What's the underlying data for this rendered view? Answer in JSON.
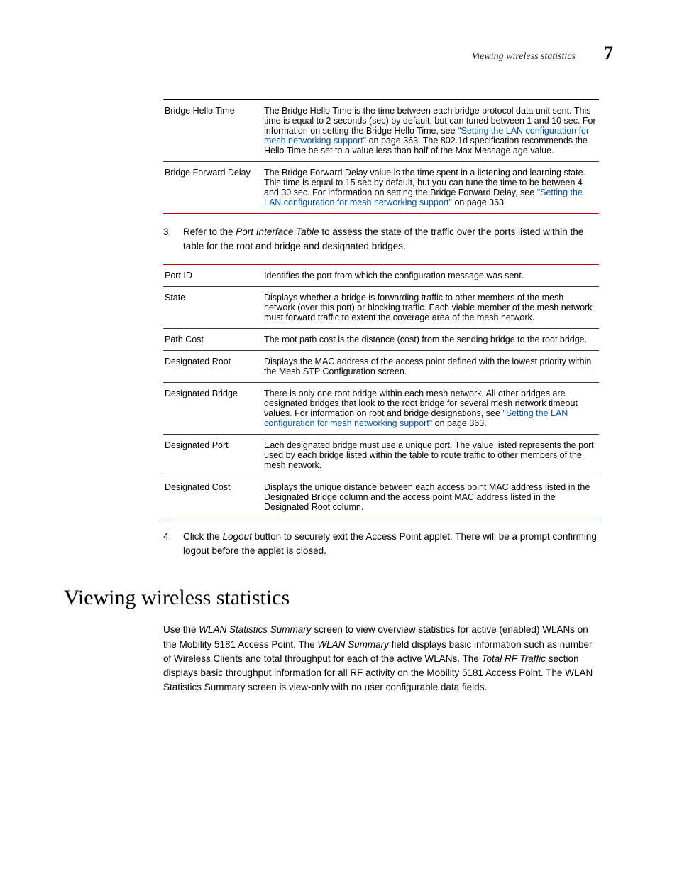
{
  "header": {
    "title": "Viewing wireless statistics",
    "chapter": "7"
  },
  "table1": {
    "rows": [
      {
        "term": "Bridge Hello Time",
        "desc_a": "The Bridge Hello Time is the time between each bridge protocol data unit sent. This time is equal to 2 seconds (sec) by default, but can tuned between 1 and 10 sec. For information on setting the Bridge Hello Time, see ",
        "link": "\"Setting the LAN configuration for mesh networking support\"",
        "desc_b": " on page 363. The 802.1d specification recommends the Hello Time be set to a value less than half of the Max Message age value."
      },
      {
        "term": "Bridge Forward Delay",
        "desc_a": "The Bridge Forward Delay value is the time spent in a listening and learning state. This time is equal to 15 sec by default, but you can tune the time to be between 4 and 30 sec. For information on setting the Bridge Forward Delay, see ",
        "link": "\"Setting the LAN configuration for mesh networking support\"",
        "desc_b": " on page 363."
      }
    ]
  },
  "step3": {
    "num": "3.",
    "a": "Refer to the ",
    "i": "Port Interface Table",
    "b": " to assess the state of the traffic over the ports listed within the table for the root and bridge and designated bridges."
  },
  "table2": {
    "rows": [
      {
        "term": "Port ID",
        "desc": "Identifies the port from which the configuration message was sent."
      },
      {
        "term": "State",
        "desc": "Displays whether a bridge is forwarding traffic to other members of the mesh network (over this port) or blocking traffic. Each viable member of the mesh network must forward traffic to extent the coverage area of the mesh network."
      },
      {
        "term": "Path Cost",
        "desc": "The root path cost is the distance (cost) from the sending bridge to the root bridge."
      },
      {
        "term": "Designated Root",
        "desc": "Displays the MAC address of the access point defined with the lowest priority within the Mesh STP Configuration screen."
      },
      {
        "term": "Designated Bridge",
        "desc_a": "There is only one root bridge within each mesh network. All other bridges are designated bridges that look to the root bridge for several mesh network timeout values. For information on root and bridge designations, see ",
        "link": "\"Setting the LAN configuration for mesh networking support\"",
        "desc_b": " on page 363."
      },
      {
        "term": "Designated Port",
        "desc": "Each designated bridge must use a unique port. The value listed represents the port used by each bridge listed within the table to route traffic to other members of the mesh network."
      },
      {
        "term": "Designated Cost",
        "desc": "Displays the unique distance between each access point MAC address listed in the Designated Bridge column and the access point MAC address listed in the Designated Root column."
      }
    ]
  },
  "step4": {
    "num": "4.",
    "a": "Click the ",
    "i": "Logout",
    "b": " button to securely exit the Access Point applet. There will be a prompt confirming logout before the applet is closed."
  },
  "section": {
    "title": "Viewing wireless statistics"
  },
  "para": {
    "a": "Use the ",
    "i1": "WLAN Statistics Summary",
    "b": " screen to view overview statistics for active (enabled) WLANs on the Mobility 5181 Access Point. The ",
    "i2": "WLAN Summary",
    "c": " field displays basic information such as number of Wireless Clients and total throughput for each of the active WLANs. The ",
    "i3": "Total RF Traffic",
    "d": " section displays basic throughput information for all RF activity on the Mobility 5181 Access Point. The WLAN Statistics Summary screen is view-only with no user configurable data fields."
  }
}
